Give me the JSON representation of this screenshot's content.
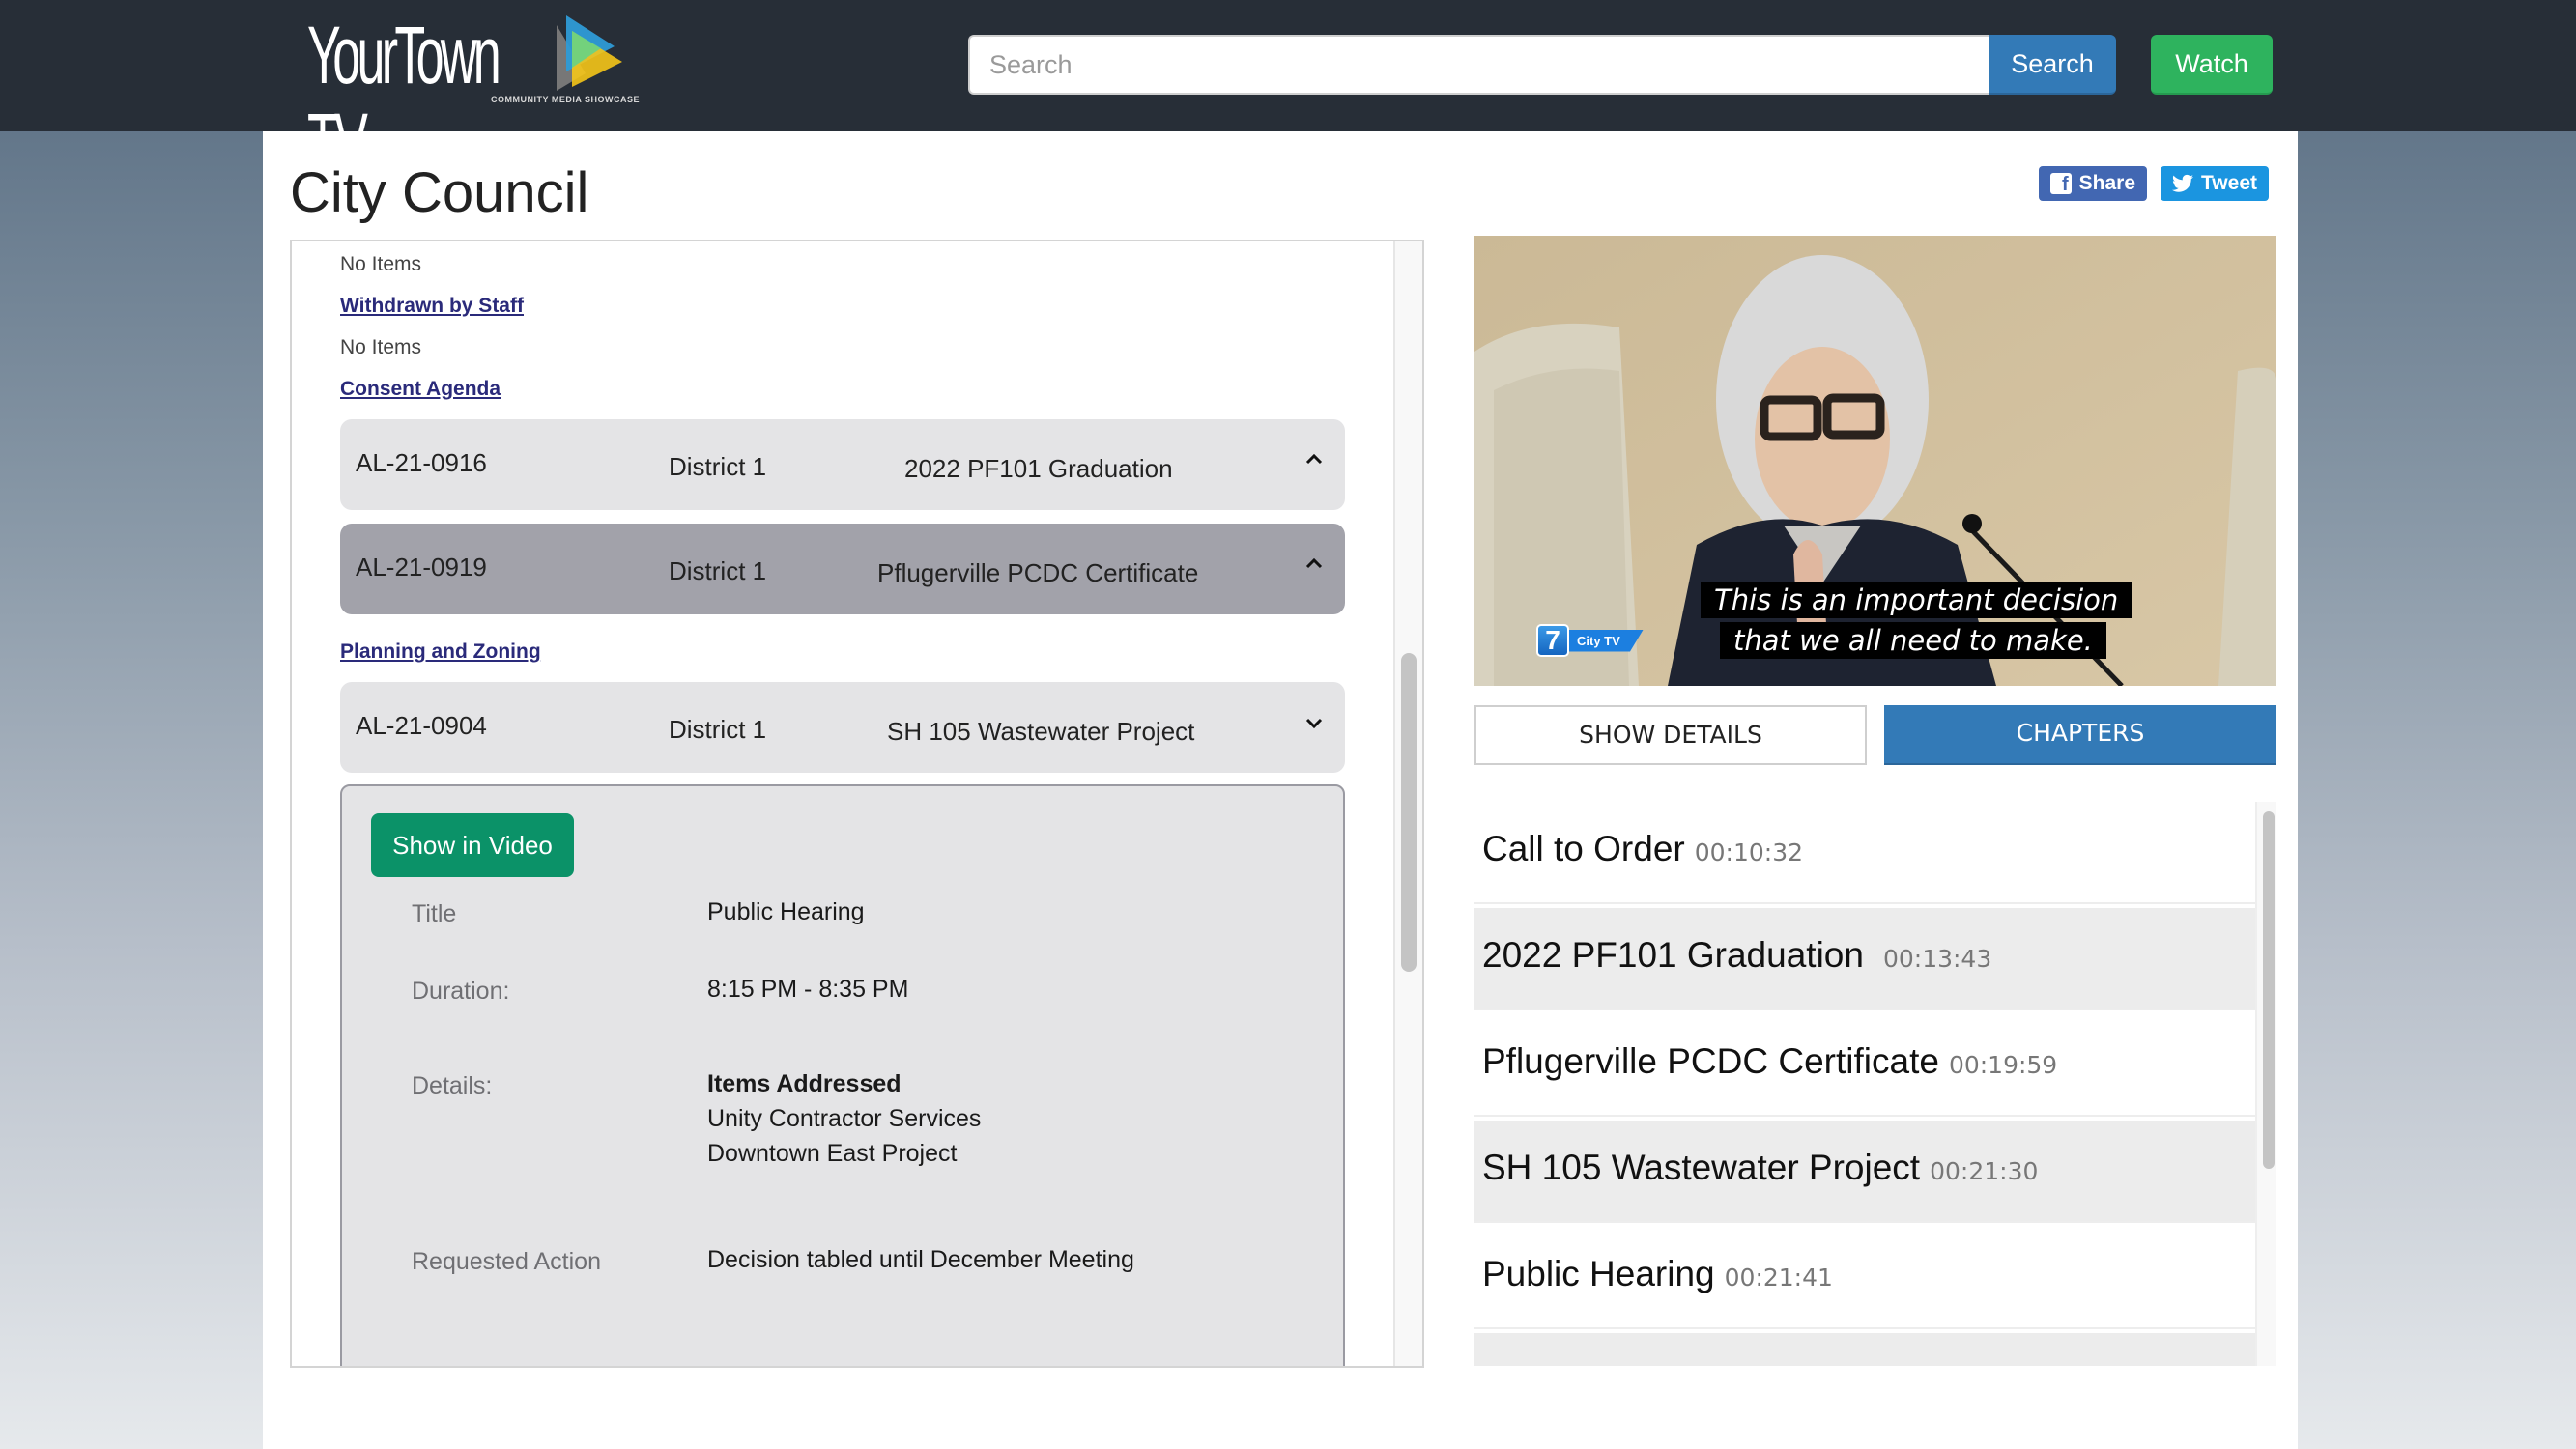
{
  "header": {
    "logo_text": "YourTown TV",
    "logo_subtitle": "COMMUNITY MEDIA SHOWCASE",
    "search_placeholder": "Search",
    "search_value": "",
    "search_button": "Search",
    "watch_button": "Watch",
    "colors": {
      "bar": "#272e37",
      "search": "#337ab7",
      "watch": "#2eb35e"
    }
  },
  "page": {
    "title": "City Council",
    "share_label": "Share",
    "tweet_label": "Tweet"
  },
  "agenda": {
    "sections": [
      {
        "name": null,
        "empty_text": "No Items"
      },
      {
        "name": "Withdrawn by Staff",
        "empty_text": "No Items"
      },
      {
        "name": "Consent Agenda"
      },
      {
        "name": "Planning and Zoning"
      }
    ],
    "items": [
      {
        "id": "AL-21-0916",
        "district": "District 1",
        "title": "2022 PF101 Graduation",
        "expanded": true,
        "active": false
      },
      {
        "id": "AL-21-0919",
        "district": "District 1",
        "title": "Pflugerville PCDC Certificate",
        "expanded": true,
        "active": true
      },
      {
        "id": "AL-21-0904",
        "district": "District 1",
        "title": "SH 105 Wastewater Project",
        "expanded": false,
        "active": false
      }
    ],
    "detail": {
      "show_in_video": "Show in Video",
      "title_label": "Title",
      "title_value": "Public Hearing",
      "duration_label": "Duration:",
      "duration_value": "8:15 PM - 8:35 PM",
      "details_label": "Details:",
      "details_heading": "Items Addressed",
      "details_lines": [
        "Unity Contractor Services",
        "Downtown East Project"
      ],
      "action_label": "Requested Action",
      "action_value": "Decision tabled until December Meeting"
    }
  },
  "video": {
    "caption_lines": [
      "This is an important decision",
      "that we all need to make."
    ],
    "channel_number": "7",
    "channel_name": "City TV"
  },
  "tabs": [
    {
      "label": "SHOW DETAILS",
      "active": false
    },
    {
      "label": "CHAPTERS",
      "active": true
    }
  ],
  "chapters": [
    {
      "name": "Call to Order",
      "time": "00:10:32"
    },
    {
      "name": "2022 PF101 Graduation",
      "time": "00:13:43"
    },
    {
      "name": "Pflugerville PCDC Certificate",
      "time": "00:19:59"
    },
    {
      "name": "SH 105 Wastewater Project",
      "time": "00:21:30"
    },
    {
      "name": "Public Hearing",
      "time": "00:21:41"
    }
  ]
}
